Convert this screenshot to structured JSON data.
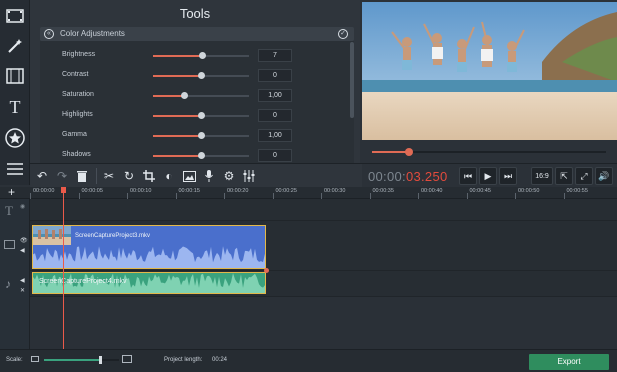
{
  "tools_panel": {
    "title": "Tools",
    "section_title": "Color Adjustments",
    "adjustments": [
      {
        "label": "Brightness",
        "value": "7",
        "level": 0.52
      },
      {
        "label": "Contrast",
        "value": "0",
        "level": 0.5
      },
      {
        "label": "Saturation",
        "value": "1,00",
        "level": 0.33
      },
      {
        "label": "Highlights",
        "value": "0",
        "level": 0.5
      },
      {
        "label": "Gamma",
        "value": "1,00",
        "level": 0.5
      },
      {
        "label": "Shadows",
        "value": "0",
        "level": 0.5
      }
    ]
  },
  "player": {
    "timecode_dim": "00:00:",
    "timecode_active": "03.250",
    "progress": 0.16,
    "aspect_label": "16:9"
  },
  "timeline": {
    "ruler_labels": [
      "00:00:00",
      "00:00:05",
      "00:00:10",
      "00:00:15",
      "00:00:20",
      "00:00:25",
      "00:00:30",
      "00:00:35",
      "00:00:40",
      "00:00:45",
      "00:00:50",
      "00:00:55"
    ],
    "video_clip_name": "ScreenCaptureProject3.mkv",
    "audio_clip_name": "ScreenCaptureProject4.mkv"
  },
  "footer": {
    "scale_label": "Scale:",
    "project_length_label": "Project length:",
    "project_length_value": "00:24",
    "export_label": "Export",
    "scale_level": 0.75
  },
  "colors": {
    "accent": "#e06b55",
    "export": "#2f8d5e",
    "video_clip": "#4a6fcc",
    "audio_clip": "#3aa27e",
    "clip_border": "#e2b84a"
  }
}
